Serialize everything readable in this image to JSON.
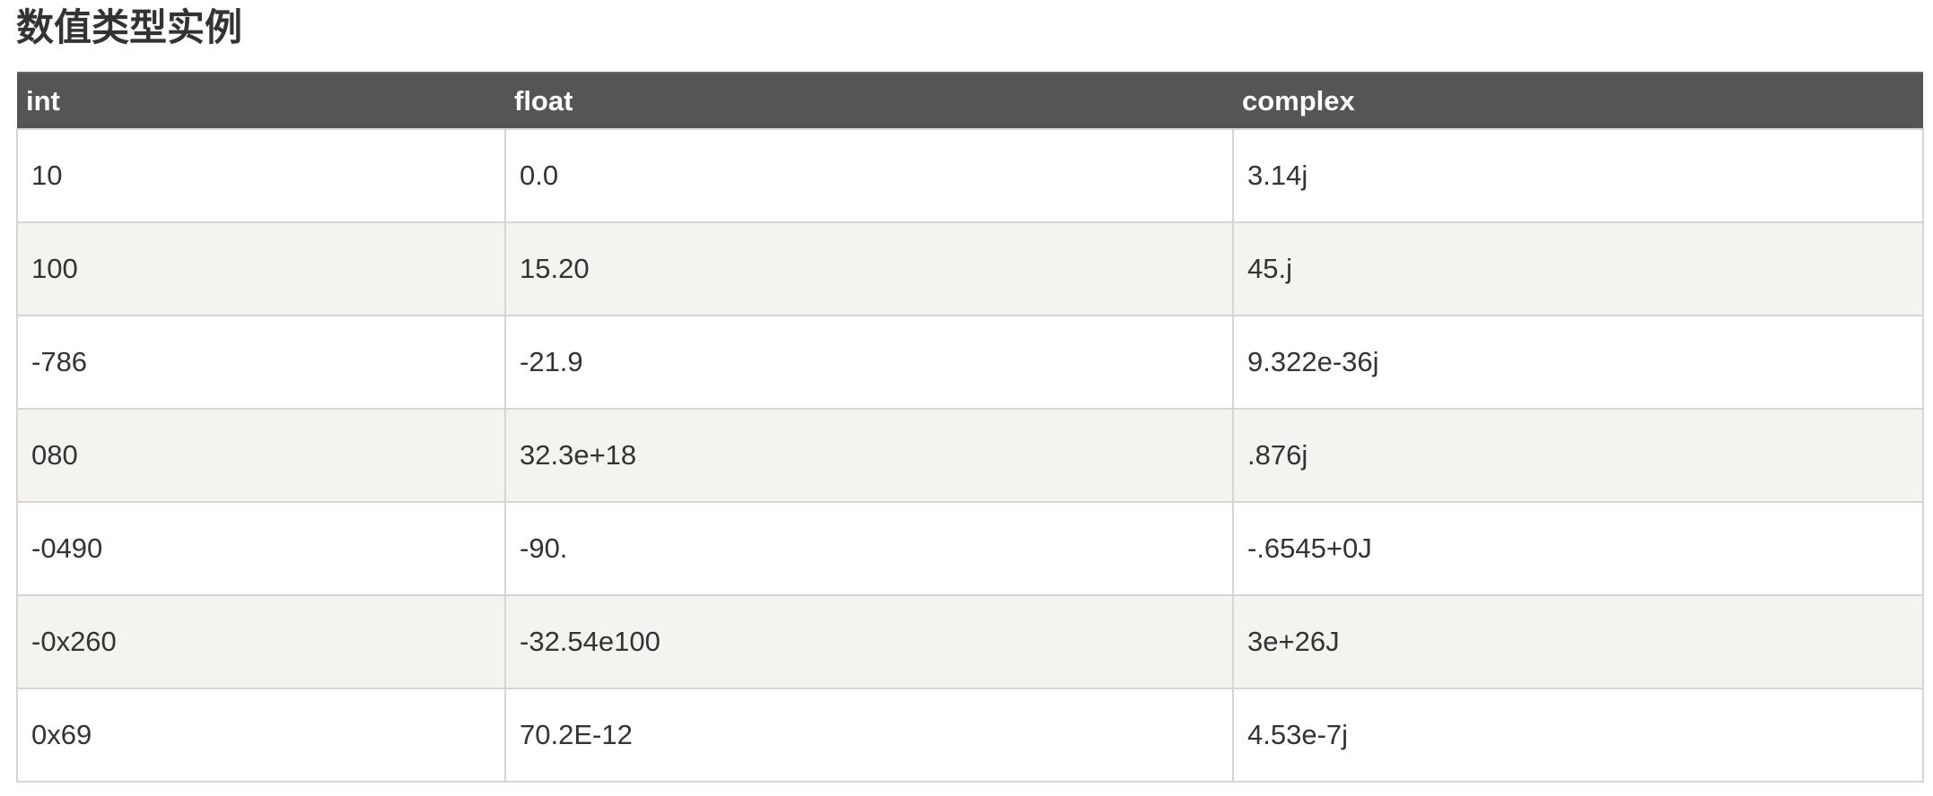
{
  "title": "数值类型实例",
  "table": {
    "headers": [
      "int",
      "float",
      "complex"
    ],
    "rows": [
      [
        "10",
        "0.0",
        "3.14j"
      ],
      [
        "100",
        "15.20",
        "45.j"
      ],
      [
        "-786",
        "-21.9",
        "9.322e-36j"
      ],
      [
        "080",
        "32.3e+18",
        ".876j"
      ],
      [
        "-0490",
        "-90.",
        "-.6545+0J"
      ],
      [
        "-0x260",
        "-32.54e100",
        "3e+26J"
      ],
      [
        "0x69",
        "70.2E-12",
        "4.53e-7j"
      ]
    ]
  },
  "colors": {
    "header_bg": "#555555",
    "header_text": "#ffffff",
    "row_alt_bg": "#f4f3f0",
    "border": "#d6d6d6",
    "text": "#333333"
  }
}
